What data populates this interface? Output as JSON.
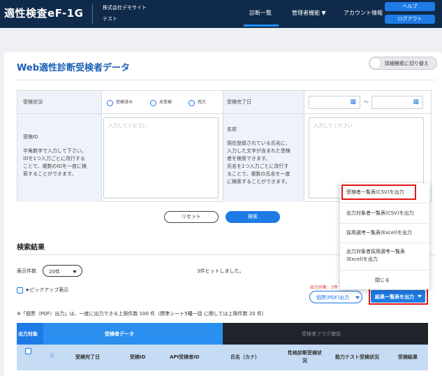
{
  "header": {
    "logo": "適性検査eF-1G",
    "company": "株式会社デモサイト",
    "company_sub": "テスト",
    "nav": [
      "診断一覧",
      "管理者機能 ▼",
      "アカウント情報"
    ],
    "help": "ヘルプ",
    "logout": "ログアウト"
  },
  "page": {
    "title": "Web適性診断受検者データ",
    "detail_toggle": "詳細検索に切り替え"
  },
  "form": {
    "status_label": "受検状況",
    "status_options": [
      "受検済み",
      "未受検",
      "両方"
    ],
    "complete_date_label": "受検完了日",
    "date_sep": "〜",
    "id_label": "受検ID",
    "id_help": [
      "半角数字で入力して下さい。",
      "IDを1つ入力ごとに改行する",
      "ことで、複数のIDを一度に検",
      "索することができます。"
    ],
    "id_placeholder": "入力してください",
    "name_label": "名前",
    "name_help": [
      "現在登録されている氏名に、",
      "入力した文字が含まれた受検",
      "者を検索できます。",
      "氏名を1つ入力ごとに改行す",
      "ることで、複数の氏名を一度",
      "に検索することができます。"
    ],
    "name_placeholder": "入力してください"
  },
  "buttons": {
    "reset": "リセット",
    "search": "検索"
  },
  "results": {
    "title": "検索結果",
    "per_page_label": "表示件数",
    "per_page_value": "20件",
    "hits": "3件ヒットしました。",
    "pickup": "★ピックアップ表示",
    "output_count": "出力対象：3件",
    "pdf_button": "個票(PDF)出力",
    "export_button": "結果一覧表を出力",
    "note": "※「個票（PDF）出力」は、一度に出力できる上限件数 100 件（標準シート5種一括 に関しては上限件数 20 件）"
  },
  "table": {
    "group_output": "出力対象",
    "group_data": "受検者データ",
    "group_flag": "受検者フラグ確認",
    "columns": [
      "受検完了日",
      "受検ID",
      "API受検者ID",
      "氏名（カナ）",
      [
        "性格診断受検状",
        "況"
      ],
      "能力テスト受検状況",
      "受検結果"
    ]
  },
  "menu": {
    "items": [
      [
        "受検者一覧表(CSV)を出力"
      ],
      [
        "出力対象者一覧表(CSV)を出力"
      ],
      [
        "採用選考一覧表(Excel)を出力"
      ],
      [
        "出力対象者採用選考一覧表",
        "(Excel)を出力"
      ]
    ],
    "close": "閉じる"
  },
  "colors": {
    "header_bg": "#0f2a4a",
    "accent": "#1e7be6",
    "highlight": "#e01818",
    "flag_header": "#1f232a"
  }
}
